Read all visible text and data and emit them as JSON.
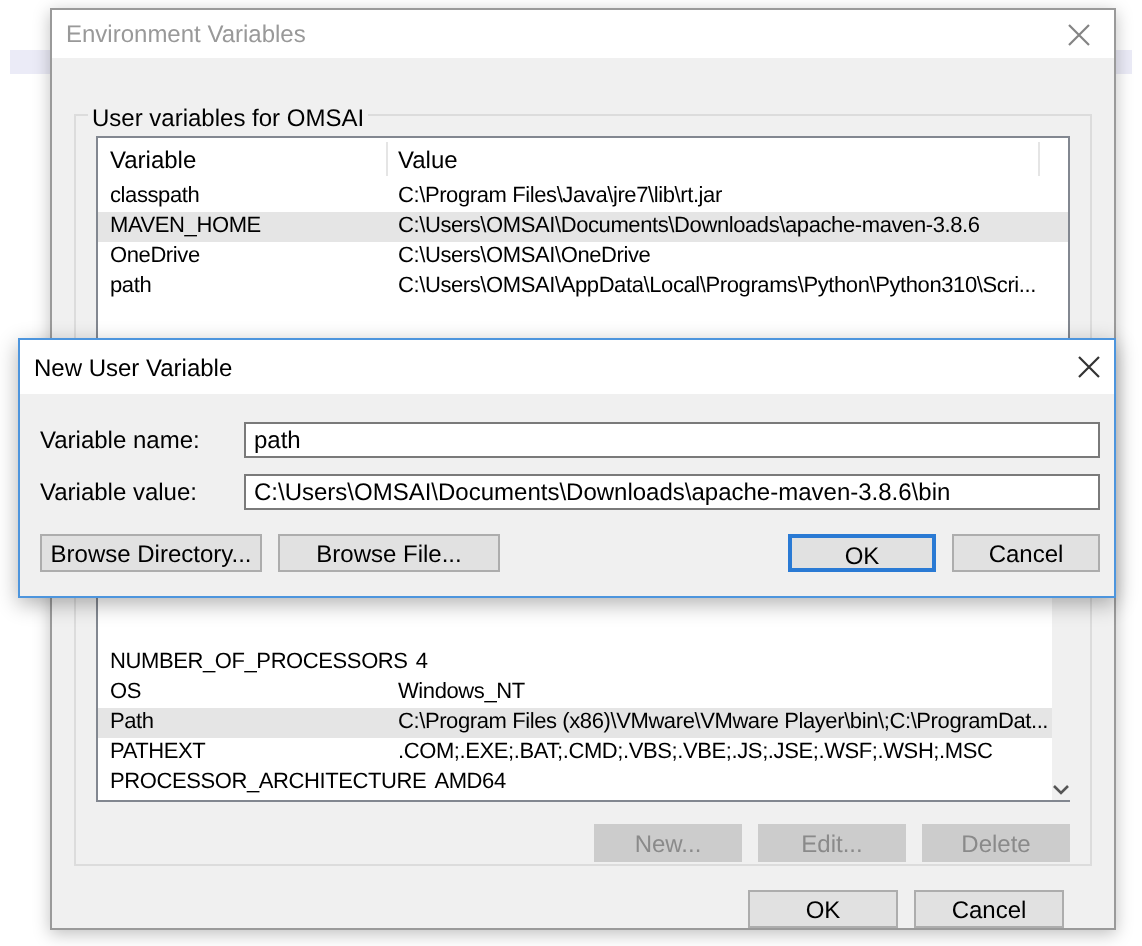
{
  "main_window": {
    "title": "Environment Variables",
    "user_variables": {
      "label": "User variables for OMSAI",
      "columns": [
        "Variable",
        "Value"
      ],
      "rows": [
        {
          "variable": "classpath",
          "value": "C:\\Program Files\\Java\\jre7\\lib\\rt.jar",
          "selected": false
        },
        {
          "variable": "MAVEN_HOME",
          "value": "C:\\Users\\OMSAI\\Documents\\Downloads\\apache-maven-3.8.6",
          "selected": true
        },
        {
          "variable": "OneDrive",
          "value": "C:\\Users\\OMSAI\\OneDrive",
          "selected": false
        },
        {
          "variable": "path",
          "value": "C:\\Users\\OMSAI\\AppData\\Local\\Programs\\Python\\Python310\\Scri...",
          "selected": false
        }
      ]
    },
    "system_variables": {
      "rows": [
        {
          "variable": "NUMBER_OF_PROCESSORS",
          "value": "4",
          "selected": false
        },
        {
          "variable": "OS",
          "value": "Windows_NT",
          "selected": false
        },
        {
          "variable": "Path",
          "value": "C:\\Program Files (x86)\\VMware\\VMware Player\\bin\\;C:\\ProgramDat...",
          "selected": true
        },
        {
          "variable": "PATHEXT",
          "value": ".COM;.EXE;.BAT;.CMD;.VBS;.VBE;.JS;.JSE;.WSF;.WSH;.MSC",
          "selected": false
        },
        {
          "variable": "PROCESSOR_ARCHITECTURE",
          "value": "AMD64",
          "selected": false
        }
      ],
      "buttons": [
        {
          "label": "New...",
          "disabled": true
        },
        {
          "label": "Edit...",
          "disabled": true
        },
        {
          "label": "Delete",
          "disabled": true
        }
      ]
    },
    "footer_buttons": [
      {
        "label": "OK"
      },
      {
        "label": "Cancel"
      }
    ]
  },
  "dialog": {
    "title": "New User Variable",
    "fields": [
      {
        "label": "Variable name:",
        "value": "path"
      },
      {
        "label": "Variable value:",
        "value": "C:\\Users\\OMSAI\\Documents\\Downloads\\apache-maven-3.8.6\\bin"
      }
    ],
    "left_buttons": [
      {
        "label": "Browse Directory...",
        "default": false
      },
      {
        "label": "Browse File...",
        "default": false
      }
    ],
    "right_buttons": [
      {
        "label": "OK",
        "default": true
      },
      {
        "label": "Cancel",
        "default": false
      }
    ]
  }
}
